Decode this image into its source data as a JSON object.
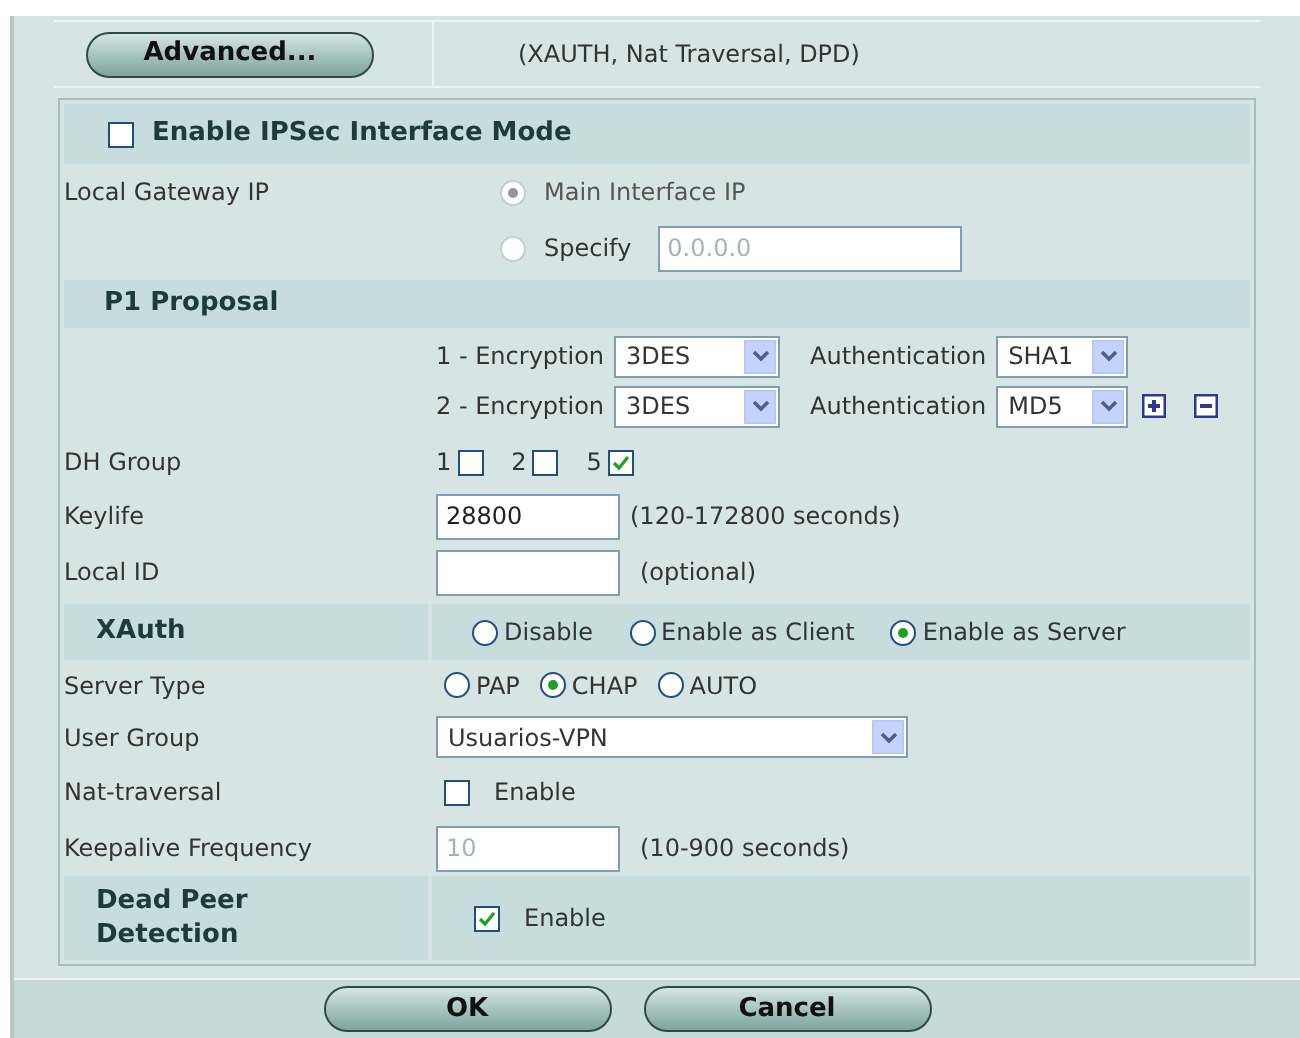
{
  "advanced": {
    "button": "Advanced...",
    "note": "(XAUTH, Nat Traversal, DPD)"
  },
  "interface_mode": {
    "label": "Enable IPSec Interface Mode",
    "checked": false
  },
  "local_gateway": {
    "label": "Local Gateway IP",
    "disabled": true,
    "options": [
      {
        "label": "Main Interface IP",
        "selected": true
      },
      {
        "label": "Specify",
        "selected": false
      }
    ],
    "specify_value": "0.0.0.0"
  },
  "p1_proposal": {
    "title": "P1 Proposal",
    "rows": [
      {
        "encryption_label": "1 - Encryption",
        "encryption": "3DES",
        "auth_label": "Authentication",
        "authentication": "SHA1",
        "add_remove": false
      },
      {
        "encryption_label": "2 - Encryption",
        "encryption": "3DES",
        "auth_label": "Authentication",
        "authentication": "MD5",
        "add_remove": true
      }
    ]
  },
  "dh_group": {
    "label": "DH Group",
    "options": [
      {
        "label": "1",
        "checked": false
      },
      {
        "label": "2",
        "checked": false
      },
      {
        "label": "5",
        "checked": true
      }
    ]
  },
  "keylife": {
    "label": "Keylife",
    "value": "28800",
    "hint": "(120-172800 seconds)"
  },
  "local_id": {
    "label": "Local ID",
    "hint": "(optional)"
  },
  "xauth": {
    "label": "XAuth",
    "options": [
      {
        "label": "Disable",
        "selected": false
      },
      {
        "label": "Enable as Client",
        "selected": false
      },
      {
        "label": "Enable as Server",
        "selected": true
      }
    ]
  },
  "server_type": {
    "label": "Server Type",
    "options": [
      {
        "label": "PAP",
        "selected": false
      },
      {
        "label": "CHAP",
        "selected": true
      },
      {
        "label": "AUTO",
        "selected": false
      }
    ]
  },
  "user_group": {
    "label": "User Group",
    "value": "Usuarios-VPN"
  },
  "nat_traversal": {
    "label": "Nat-traversal",
    "option": "Enable",
    "checked": false
  },
  "keepalive": {
    "label": "Keepalive Frequency",
    "value": "10",
    "hint": "(10-900 seconds)",
    "disabled": true
  },
  "dpd": {
    "label": "Dead Peer Detection",
    "option": "Enable",
    "checked": true
  },
  "buttons": [
    "OK",
    "Cancel"
  ]
}
